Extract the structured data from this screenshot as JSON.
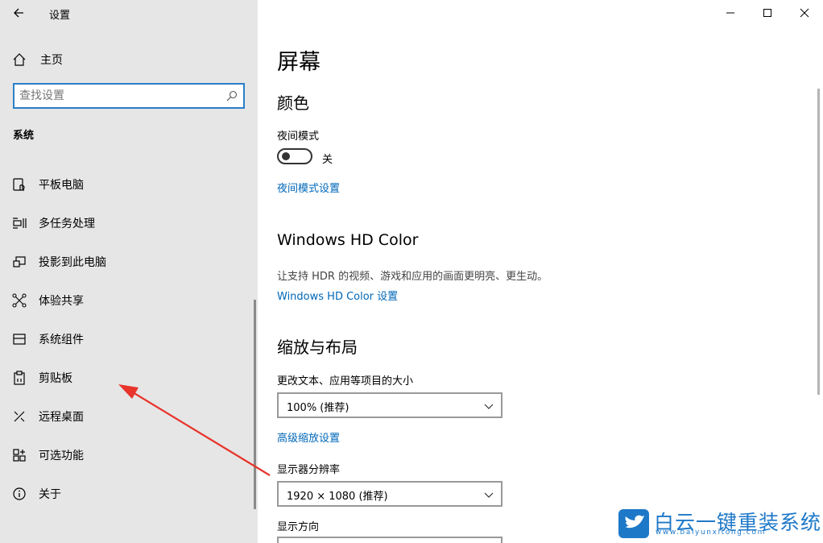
{
  "window": {
    "title": "设置"
  },
  "sidebar": {
    "home_label": "主页",
    "search_placeholder": "查找设置",
    "section_title": "系统",
    "items": [
      {
        "label": "平板电脑",
        "icon": "tablet-icon"
      },
      {
        "label": "多任务处理",
        "icon": "multitask-icon"
      },
      {
        "label": "投影到此电脑",
        "icon": "project-icon"
      },
      {
        "label": "体验共享",
        "icon": "share-icon"
      },
      {
        "label": "系统组件",
        "icon": "component-icon"
      },
      {
        "label": "剪贴板",
        "icon": "clipboard-icon"
      },
      {
        "label": "远程桌面",
        "icon": "remote-desktop-icon"
      },
      {
        "label": "可选功能",
        "icon": "optional-features-icon"
      },
      {
        "label": "关于",
        "icon": "info-icon"
      }
    ]
  },
  "main": {
    "page_title": "屏幕",
    "color": {
      "heading": "颜色",
      "night_mode_label": "夜间模式",
      "night_mode_state": "关",
      "night_mode_settings_link": "夜间模式设置"
    },
    "hdr": {
      "heading": "Windows HD Color",
      "description": "让支持 HDR 的视频、游戏和应用的画面更明亮、更生动。",
      "settings_link": "Windows HD Color 设置"
    },
    "scale": {
      "heading": "缩放与布局",
      "text_size_label": "更改文本、应用等项目的大小",
      "text_size_value": "100% (推荐)",
      "advanced_link": "高级缩放设置",
      "resolution_label": "显示器分辨率",
      "resolution_value": "1920 × 1080 (推荐)",
      "orientation_label": "显示方向"
    }
  },
  "watermark": {
    "brand": "白云一键重装系统",
    "url": "www.baiyunxitong.com"
  },
  "colors": {
    "accent": "#0067b8",
    "sidebar_bg": "#e6e6e6",
    "annotation": "#e8342b"
  }
}
